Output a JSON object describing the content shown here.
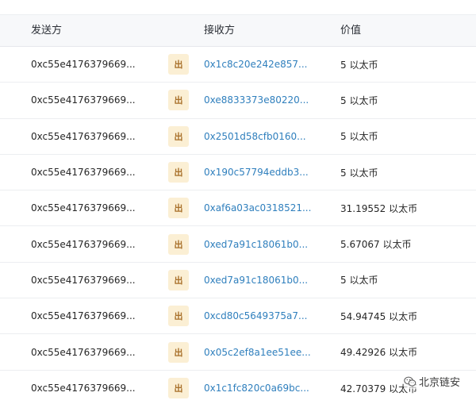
{
  "header": {
    "from_label": "发送方",
    "to_label": "接收方",
    "value_label": "价值"
  },
  "rows": [
    {
      "from": "0xc55e4176379669...",
      "direction": "出",
      "to": "0x1c8c20e242e857...",
      "value": "5 以太币"
    },
    {
      "from": "0xc55e4176379669...",
      "direction": "出",
      "to": "0xe8833373e80220...",
      "value": "5 以太币"
    },
    {
      "from": "0xc55e4176379669...",
      "direction": "出",
      "to": "0x2501d58cfb0160...",
      "value": "5 以太币"
    },
    {
      "from": "0xc55e4176379669...",
      "direction": "出",
      "to": "0x190c57794eddb3...",
      "value": "5 以太币"
    },
    {
      "from": "0xc55e4176379669...",
      "direction": "出",
      "to": "0xaf6a03ac0318521...",
      "value": "31.19552 以太币"
    },
    {
      "from": "0xc55e4176379669...",
      "direction": "出",
      "to": "0xed7a91c18061b0...",
      "value": "5.67067 以太币"
    },
    {
      "from": "0xc55e4176379669...",
      "direction": "出",
      "to": "0xed7a91c18061b0...",
      "value": "5 以太币"
    },
    {
      "from": "0xc55e4176379669...",
      "direction": "出",
      "to": "0xcd80c5649375a7...",
      "value": "54.94745 以太币"
    },
    {
      "from": "0xc55e4176379669...",
      "direction": "出",
      "to": "0x05c2ef8a1ee51ee...",
      "value": "49.42926 以太币"
    },
    {
      "from": "0xc55e4176379669...",
      "direction": "出",
      "to": "0x1c1fc820c0a69bc...",
      "value": "42.70379 以太币"
    }
  ],
  "watermark": {
    "text": "北京链安",
    "icon": "wechat-icon"
  },
  "colors": {
    "link": "#2f7fbd",
    "badge_bg": "#fbefd4",
    "badge_text": "#a8702a",
    "header_bg": "#f7f8fa"
  }
}
